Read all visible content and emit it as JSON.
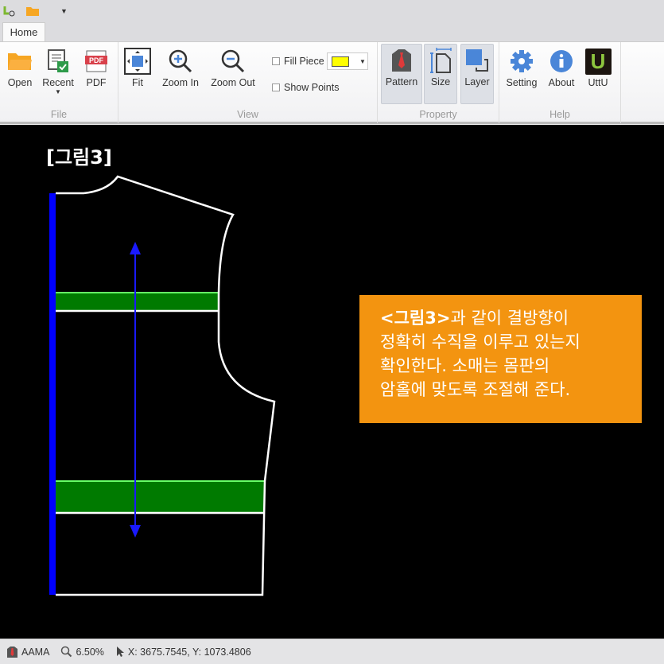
{
  "quick_access": {
    "icons": [
      "uttu-app-icon",
      "open-folder-icon",
      "customize-dropdown-icon"
    ]
  },
  "tabs": [
    {
      "label": "Home",
      "active": true
    }
  ],
  "ribbon": {
    "file": {
      "label": "File",
      "open": "Open",
      "recent": "Recent",
      "pdf": "PDF"
    },
    "view": {
      "label": "View",
      "fit": "Fit",
      "zoom_in": "Zoom In",
      "zoom_out": "Zoom Out",
      "fill_piece": "Fill Piece",
      "fill_piece_checked": false,
      "fill_color": "#ffff00",
      "show_points": "Show Points",
      "show_points_checked": false
    },
    "property": {
      "label": "Property",
      "pattern": "Pattern",
      "size": "Size",
      "layer": "Layer"
    },
    "help": {
      "label": "Help",
      "setting": "Setting",
      "about": "About",
      "uttu": "UttU",
      "uttu_logo": "U"
    }
  },
  "canvas": {
    "figure_title": "[그림3]",
    "note": {
      "bold": "<그림3>",
      "line1": "과 같이 결방향이",
      "line2": "정확히 수직을 이루고 있는지",
      "line3": "확인한다. 소매는 몸판의",
      "line4": "암홀에 맞도록 조절해 준다."
    },
    "colors": {
      "note_bg": "#f39410",
      "band": "#007a00",
      "grainline": "#1a1aff",
      "center_bar": "#0000ff"
    }
  },
  "status": {
    "format": "AAMA",
    "zoom": "6.50%",
    "coords": "X: 3675.7545, Y: 1073.4806"
  }
}
